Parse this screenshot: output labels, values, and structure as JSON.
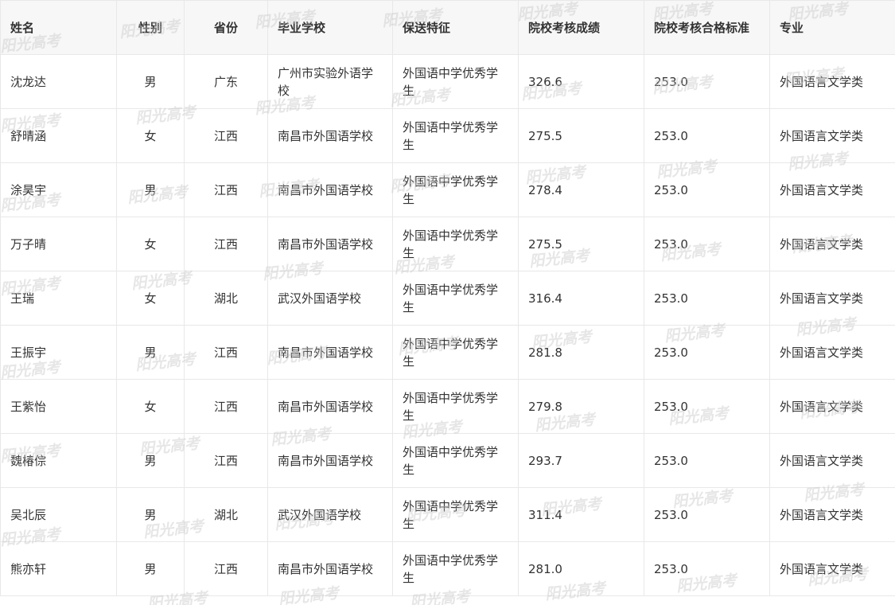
{
  "table": {
    "headers": [
      "姓名",
      "性别",
      "省份",
      "毕业学校",
      "保送特征",
      "院校考核成绩",
      "院校考核合格标准",
      "专业"
    ],
    "rows": [
      [
        "沈龙达",
        "男",
        "广东",
        "广州市实验外语学校",
        "外国语中学优秀学生",
        "326.6",
        "253.0",
        "外国语言文学类"
      ],
      [
        "舒晴涵",
        "女",
        "江西",
        "南昌市外国语学校",
        "外国语中学优秀学生",
        "275.5",
        "253.0",
        "外国语言文学类"
      ],
      [
        "涂昊宇",
        "男",
        "江西",
        "南昌市外国语学校",
        "外国语中学优秀学生",
        "278.4",
        "253.0",
        "外国语言文学类"
      ],
      [
        "万子晴",
        "女",
        "江西",
        "南昌市外国语学校",
        "外国语中学优秀学生",
        "275.5",
        "253.0",
        "外国语言文学类"
      ],
      [
        "王瑞",
        "女",
        "湖北",
        "武汉外国语学校",
        "外国语中学优秀学生",
        "316.4",
        "253.0",
        "外国语言文学类"
      ],
      [
        "王振宇",
        "男",
        "江西",
        "南昌市外国语学校",
        "外国语中学优秀学生",
        "281.8",
        "253.0",
        "外国语言文学类"
      ],
      [
        "王紫怡",
        "女",
        "江西",
        "南昌市外国语学校",
        "外国语中学优秀学生",
        "279.8",
        "253.0",
        "外国语言文学类"
      ],
      [
        "魏椿倧",
        "男",
        "江西",
        "南昌市外国语学校",
        "外国语中学优秀学生",
        "293.7",
        "253.0",
        "外国语言文学类"
      ],
      [
        "吴北辰",
        "男",
        "湖北",
        "武汉外国语学校",
        "外国语中学优秀学生",
        "311.4",
        "253.0",
        "外国语言文学类"
      ],
      [
        "熊亦轩",
        "男",
        "江西",
        "南昌市外国语学校",
        "外国语中学优秀学生",
        "281.0",
        "253.0",
        "外国语言文学类"
      ]
    ]
  },
  "watermark": {
    "text": "阳光高考"
  }
}
